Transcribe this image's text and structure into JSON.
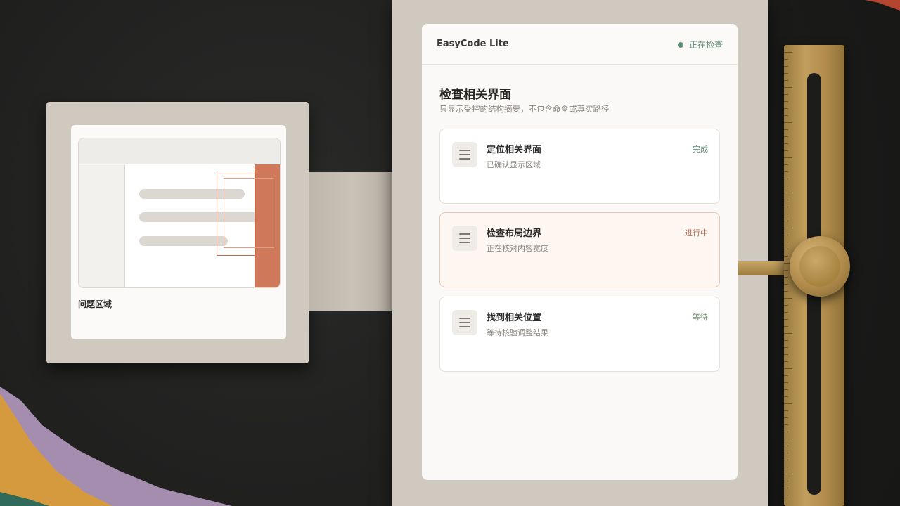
{
  "app": {
    "title": "EasyCode Lite",
    "status": "正在检查"
  },
  "page": {
    "title": "检查相关界面",
    "subtitle": "只显示受控的结构摘要，不包含命令或真实路径"
  },
  "steps": [
    {
      "title": "定位相关界面",
      "desc": "已确认显示区域",
      "status": "完成"
    },
    {
      "title": "检查布局边界",
      "desc": "正在核对内容宽度",
      "status": "进行中"
    },
    {
      "title": "找到相关位置",
      "desc": "等待核验调整结果",
      "status": "等待"
    }
  ],
  "preview": {
    "caption": "问题区域"
  },
  "colors": {
    "accent": "#d0785a",
    "status_green": "#5f8a73",
    "in_progress": "#b06a4d",
    "brass": "#b08b4b"
  },
  "icons": {
    "step_icon": "menu-lines-icon",
    "status_icon": "status-dot-icon"
  }
}
